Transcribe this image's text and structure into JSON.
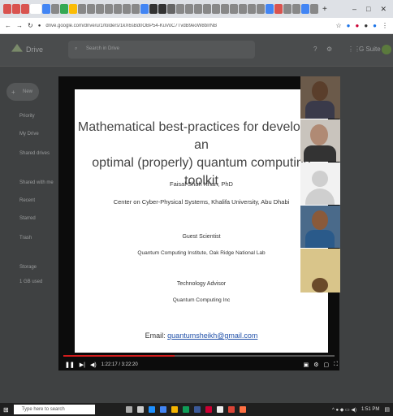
{
  "browser": {
    "url": "drive.google.com/drive/u/1/folders/1kX6sBd0OBP54-KuVoC7TvdB9eoW8bIrNB",
    "new_tab": "+",
    "window_controls": [
      "–",
      "□",
      "✕"
    ]
  },
  "drive": {
    "app_name": "Drive",
    "search_placeholder": "Search in Drive",
    "new_button": "New",
    "brand": "G Suite",
    "sidebar": [
      "Priority",
      "My Drive",
      "Shared drives",
      "Shared with me",
      "Recent",
      "Starred",
      "Trash",
      "Storage",
      "1 GB used"
    ]
  },
  "slide": {
    "title_line1": "Mathematical best-practices for developing an",
    "title_line2": "optimal (properly) quantum computing toolkit",
    "author": "Faisal Shah Khan, PhD",
    "affiliation": "Center on Cyber-Physical Systems, Khalifa University, Abu Dhabi",
    "guest_heading": "Guest Scientist",
    "guest_org": "Quantum Computing Institute, Oak Ridge National Lab",
    "advisor_heading": "Technology Advisor",
    "advisor_org": "Quantum Computing Inc",
    "email_label": "Email:",
    "email": "quantumsheikh@gmail.com"
  },
  "player": {
    "time": "1:22:17 / 3:22:20",
    "progress": 0.41
  },
  "taskbar": {
    "search_placeholder": "Type here to search",
    "clock": "1:51 PM"
  },
  "colors": {
    "accent": "#d21c1c",
    "link": "#1f4fa8"
  }
}
